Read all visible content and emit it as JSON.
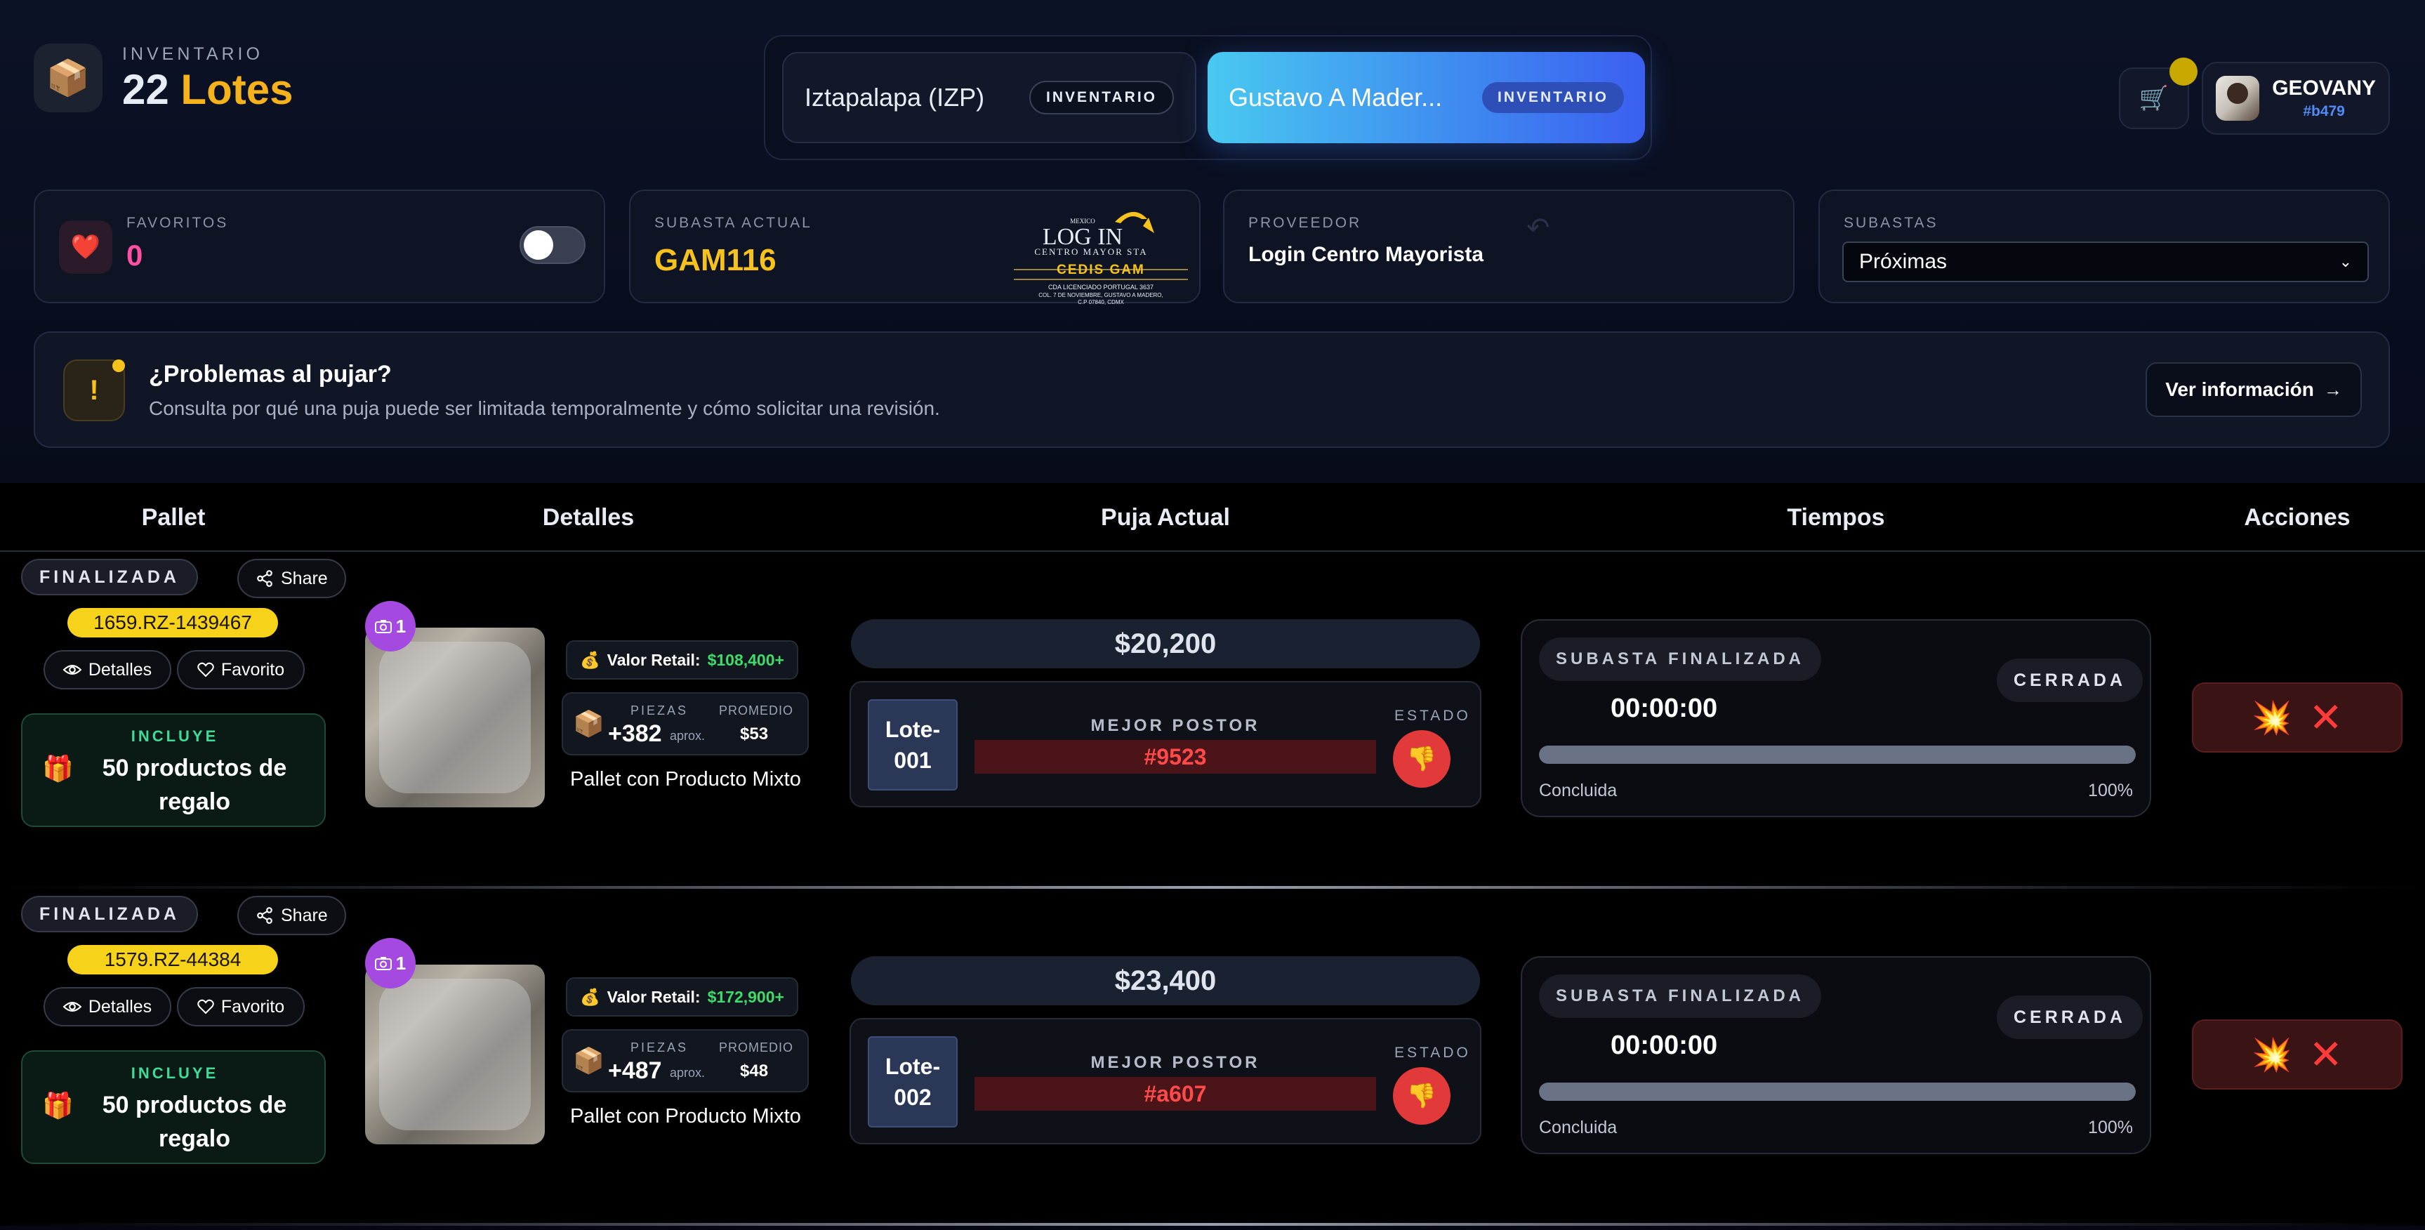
{
  "header": {
    "subtitle": "INVENTARIO",
    "lot_count": "22",
    "lot_word": "Lotes",
    "brand_icon": "box-icon"
  },
  "locations": [
    {
      "name": "Iztapalapa (IZP)",
      "badge": "INVENTARIO",
      "active": false
    },
    {
      "name": "Gustavo A Mader...",
      "badge": "INVENTARIO",
      "active": true
    }
  ],
  "user": {
    "name": "GEOVANY",
    "id": "#b479",
    "cart_icon": "cart-icon"
  },
  "stats": {
    "favorites_label": "FAVORITOS",
    "favorites_count": "0",
    "favorites_toggle_on": false,
    "auction_label": "SUBASTA ACTUAL",
    "auction_code": "GAM116",
    "logo": {
      "top": "MEXICO",
      "brand": "LOG IN",
      "sub": "CENTRO MAYOR STA",
      "branch": "CEDIS GAM",
      "address1": "CDA LICENCIADO PORTUGAL 3637",
      "address2": "COL. 7 DE NOVIEMBRE, GUSTAVO A MADERO,",
      "address3": "C.P 07840, CDMX"
    },
    "provider_label": "PROVEEDOR",
    "provider_name": "Login Centro Mayorista",
    "auctions_label": "SUBASTAS",
    "auctions_selected": "Próximas"
  },
  "banner": {
    "title": "¿Problemas al pujar?",
    "description": "Consulta por qué una puja puede ser limitada temporalmente y cómo solicitar una revisión.",
    "button": "Ver información"
  },
  "table": {
    "columns": [
      "Pallet",
      "Detalles",
      "Puja Actual",
      "Tiempos",
      "Acciones"
    ]
  },
  "lots": [
    {
      "status": "FINALIZADA",
      "share": "Share",
      "code": "1659.RZ-1439467",
      "details_btn": "Detalles",
      "favorite_btn": "Favorito",
      "gift_label": "INCLUYE",
      "gift_text": "50 productos de regalo",
      "photo_count": "1",
      "retail_label": "Valor Retail:",
      "retail_value": "$108,400+",
      "pieces_label": "PIEZAS",
      "pieces_value": "+382",
      "pieces_aprox": "aprox.",
      "avg_label": "PROMEDIO",
      "avg_value": "$53",
      "type": "Pallet con Producto Mixto",
      "price": "$20,200",
      "lot_tag": "Lote-001",
      "bidder_label": "MEJOR POSTOR",
      "bidder": "#9523",
      "estado_label": "ESTADO",
      "time_status": "SUBASTA FINALIZADA",
      "closed": "CERRADA",
      "timer": "00:00:00",
      "progress_pct": 100,
      "progress_label": "Concluida",
      "progress_text": "100%"
    },
    {
      "status": "FINALIZADA",
      "share": "Share",
      "code": "1579.RZ-44384",
      "details_btn": "Detalles",
      "favorite_btn": "Favorito",
      "gift_label": "INCLUYE",
      "gift_text": "50 productos de regalo",
      "photo_count": "1",
      "retail_label": "Valor Retail:",
      "retail_value": "$172,900+",
      "pieces_label": "PIEZAS",
      "pieces_value": "+487",
      "pieces_aprox": "aprox.",
      "avg_label": "PROMEDIO",
      "avg_value": "$48",
      "type": "Pallet con Producto Mixto",
      "price": "$23,400",
      "lot_tag": "Lote-002",
      "bidder_label": "MEJOR POSTOR",
      "bidder": "#a607",
      "estado_label": "ESTADO",
      "time_status": "SUBASTA FINALIZADA",
      "closed": "CERRADA",
      "timer": "00:00:00",
      "progress_pct": 100,
      "progress_label": "Concluida",
      "progress_text": "100%"
    }
  ],
  "colors": {
    "accent_gold": "#f6b21b",
    "active_tab": "#3f8df0",
    "bidder_red": "#ff4a4a",
    "retail_green": "#3ddc6a"
  }
}
